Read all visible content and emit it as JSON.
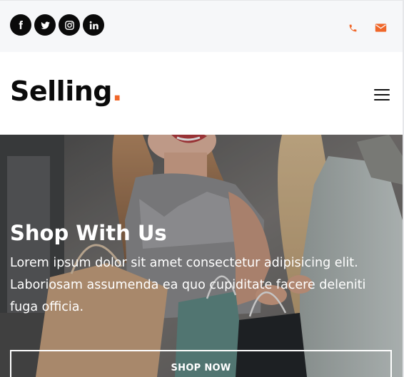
{
  "topbar": {
    "social": [
      {
        "icon": "facebook-icon"
      },
      {
        "icon": "twitter-icon"
      },
      {
        "icon": "instagram-icon"
      },
      {
        "icon": "linkedin-icon"
      }
    ],
    "contact": [
      {
        "icon": "phone-icon"
      },
      {
        "icon": "envelope-icon"
      }
    ]
  },
  "header": {
    "logo_text": "Selling",
    "logo_dot": ".",
    "menu_icon": "hamburger-menu-icon"
  },
  "hero": {
    "title": "Shop With Us",
    "text": "Lorem ipsum dolor sit amet consectetur adipisicing elit. Laboriosam assumenda ea quo cupiditate facere deleniti fuga officia.",
    "button_label": "SHOP NOW"
  },
  "colors": {
    "accent": "#f0672a",
    "dark": "#0b0b0b",
    "topbar_bg": "#f6f7f9"
  }
}
